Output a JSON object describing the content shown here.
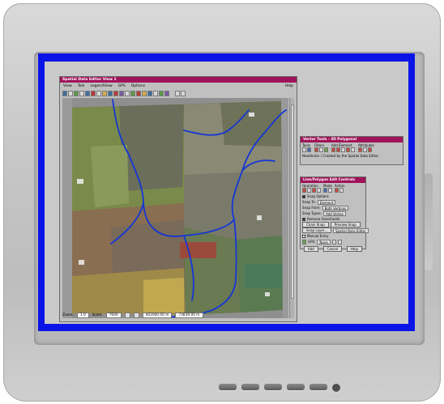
{
  "main_window": {
    "title": "Spatial Data Editor View 1",
    "menu": [
      "View",
      "Tool",
      "LegendView",
      "GPS",
      "Options"
    ],
    "help": "Help"
  },
  "status": {
    "zoom_label": "Zoom:",
    "zoom_value": "1.0",
    "scale_label": "Scale:",
    "scale_value": "7600",
    "x_coord": "402000.00 m",
    "y_coord": "73839.00 m"
  },
  "vector_tools": {
    "title": "Vector Tools - 3D Polygonal",
    "groups": [
      "Tools",
      "Filters",
      "Add Element",
      "Attributes"
    ],
    "status": "NewVector / Created by the Spatial Data Editor"
  },
  "line_controls": {
    "title": "Line/Polygon Edit Controls",
    "groups": [
      "Operation",
      "Mode",
      "Action"
    ],
    "snap_options": "Snap Options",
    "snap_to_label": "Snap To:",
    "snap_to_value": "Element",
    "snap_from_label": "Snap From:",
    "snap_from_value": "Both Vertices",
    "snap_types_label": "Snap Types:",
    "snap_types_value": "Add Vertex",
    "remove_overshoots": "Remove Overshoots",
    "chain_snap": "Chain Snap",
    "preview_snap": "Preview Snap",
    "snap_layer": "Snap Layer...",
    "snap_layer_value": "Spatial Data Editor",
    "manual_entry": "Manual Entry",
    "gps_label": "GPS:",
    "gps_value": "None",
    "buttons": [
      "Add",
      "Cancel",
      "Help"
    ]
  },
  "colors": {
    "screen_border": "#0a14e6",
    "titlebar": "#a0135a",
    "stream": "#1436d6"
  }
}
